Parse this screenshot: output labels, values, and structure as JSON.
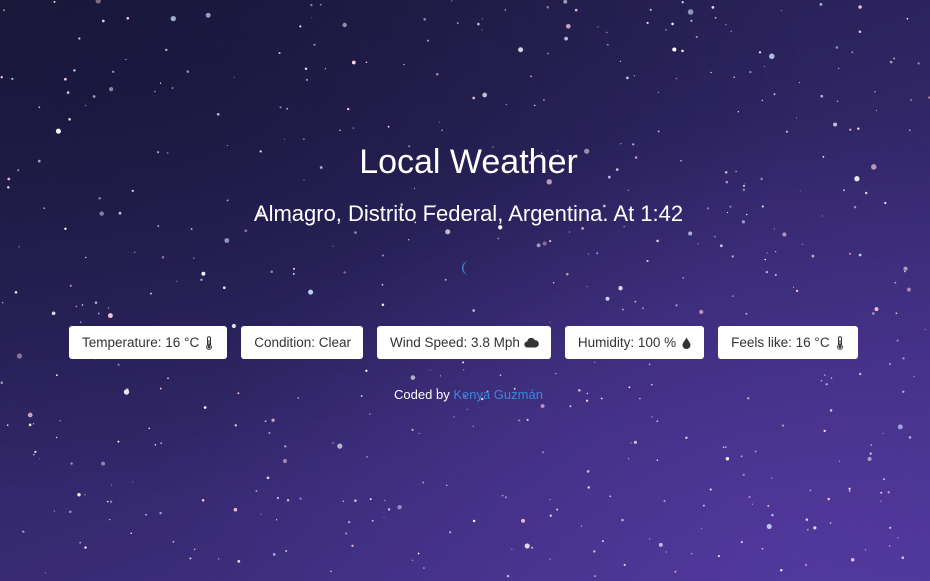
{
  "header": {
    "title": "Local Weather",
    "location": "Almagro, Distrito Federal, Argentina. At 1:42"
  },
  "current_icon": "crescent-moon-icon",
  "stats": [
    {
      "label": "Temperature: 16 °C",
      "icon": "thermometer-icon"
    },
    {
      "label": "Condition: Clear",
      "icon": ""
    },
    {
      "label": "Wind Speed: 3.8 Mph",
      "icon": "cloud-icon"
    },
    {
      "label": "Humidity: 100 %",
      "icon": "droplet-icon"
    },
    {
      "label": "Feels like: 16 °C",
      "icon": "thermometer-icon"
    }
  ],
  "footer": {
    "prefix": "Coded by",
    "author": "Kenya Guzmán"
  },
  "colors": {
    "link": "#3b86d9",
    "moon": "#3b86d9",
    "card_bg": "#ffffff",
    "card_text": "#333333"
  }
}
